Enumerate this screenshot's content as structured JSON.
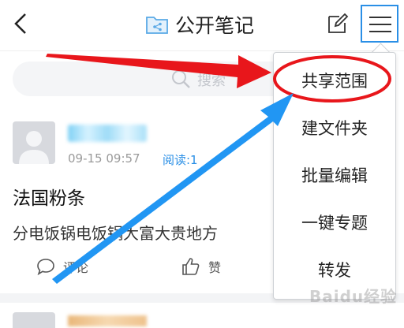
{
  "header": {
    "title": "公开笔记",
    "icons": [
      "back-icon",
      "folder-share-icon",
      "edit-icon",
      "menu-icon"
    ]
  },
  "search": {
    "placeholder": "搜索"
  },
  "post": {
    "time": "09-15 09:57",
    "read": "阅读:1",
    "title": "法国粉条",
    "body": "分电饭锅电饭锅大富大贵地方",
    "comment_label": "评论",
    "like_label": "赞"
  },
  "menu": {
    "items": [
      "共享范围",
      "建文件夹",
      "批量编辑",
      "一键专题",
      "转发"
    ]
  },
  "watermark": "Baidu经验",
  "colors": {
    "accent_blue": "#2a8fe6",
    "annotation_red": "#e8161b",
    "annotation_blue": "#2196f3"
  }
}
